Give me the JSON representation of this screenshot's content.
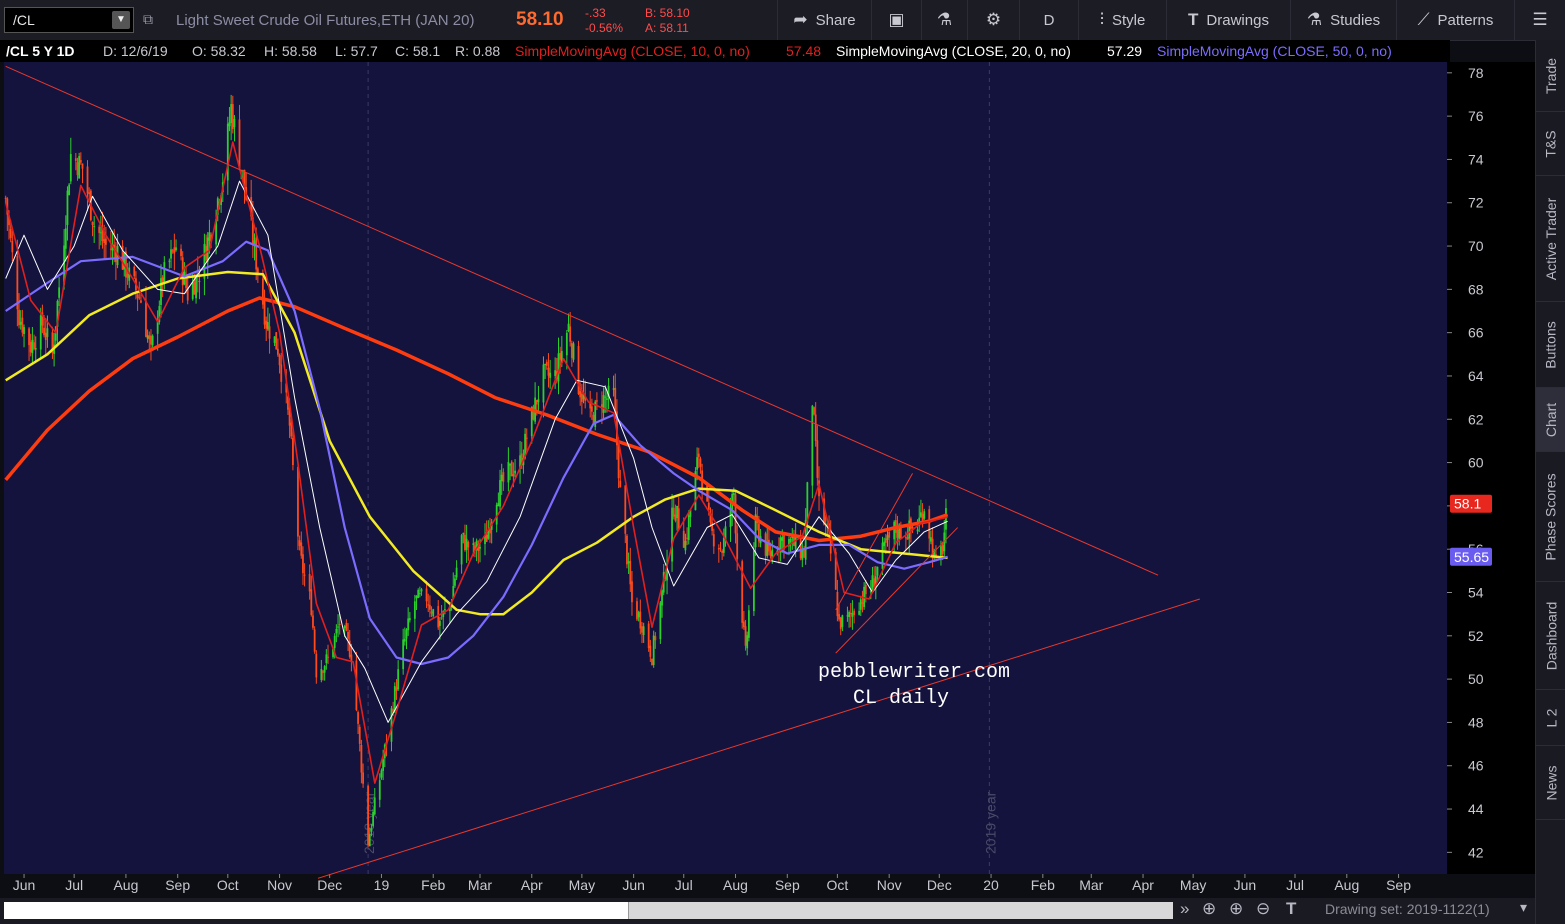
{
  "toolbar": {
    "symbol": "/CL",
    "description": "Light Sweet Crude Oil Futures,ETH (JAN 20)",
    "last": "58.10",
    "net_change": "-.33",
    "pct_change": "-0.56%",
    "bid": "B: 58.10",
    "ask": "A: 58.11",
    "share_label": "Share",
    "aggregation_label": "D",
    "style_label": "Style",
    "drawings_label": "Drawings",
    "studies_label": "Studies",
    "patterns_label": "Patterns"
  },
  "study_header": {
    "symbol_period": "/CL 5 Y 1D",
    "date": "D: 12/6/19",
    "open": "O: 58.32",
    "high": "H: 58.58",
    "low": "L: 57.7",
    "close": "C: 58.1",
    "range": "R: 0.88",
    "sma10_label": "SimpleMovingAvg (CLOSE, 10, 0, no)",
    "sma10_value": "57.48",
    "sma20_label": "SimpleMovingAvg (CLOSE, 20, 0, no)",
    "sma20_value": "57.29",
    "sma50_label": "SimpleMovingAvg (CLOSE, 50, 0, no)"
  },
  "right_tabs": [
    "Trade",
    "T&S",
    "Active Trader",
    "Buttons",
    "Chart",
    "Phase Scores",
    "Dashboard",
    "L 2",
    "News"
  ],
  "status_bar": {
    "drawing_set": "Drawing set: 2019-1122(1)"
  },
  "colors": {
    "background": "#13133d",
    "candle_up": "#2bd12b",
    "candle_down": "#ff4a1c",
    "sma10": "#e02020",
    "sma20": "#ffffff",
    "sma50": "#7b6cff",
    "sma100": "#f2ea22",
    "sma200": "#ff3c0f",
    "trendline": "#e8382d"
  },
  "chart_data": {
    "type": "candlestick",
    "title": "/CL 5 Y 1D",
    "ylim": [
      41,
      78.5
    ],
    "y_ticks": [
      42,
      44,
      46,
      48,
      50,
      52,
      54,
      56,
      58,
      60,
      62,
      64,
      66,
      68,
      70,
      72,
      74,
      76,
      78
    ],
    "x_range": [
      "2018-05-20",
      "2020-09-30"
    ],
    "x_ticks": [
      {
        "label": "Jun",
        "date": "2018-06-01"
      },
      {
        "label": "Jul",
        "date": "2018-07-01"
      },
      {
        "label": "Aug",
        "date": "2018-08-01"
      },
      {
        "label": "Sep",
        "date": "2018-09-01"
      },
      {
        "label": "Oct",
        "date": "2018-10-01"
      },
      {
        "label": "Nov",
        "date": "2018-11-01"
      },
      {
        "label": "Dec",
        "date": "2018-12-01"
      },
      {
        "label": "19",
        "date": "2019-01-01"
      },
      {
        "label": "Feb",
        "date": "2019-02-01"
      },
      {
        "label": "Mar",
        "date": "2019-03-01"
      },
      {
        "label": "Apr",
        "date": "2019-04-01"
      },
      {
        "label": "May",
        "date": "2019-05-01"
      },
      {
        "label": "Jun",
        "date": "2019-06-01"
      },
      {
        "label": "Jul",
        "date": "2019-07-01"
      },
      {
        "label": "Aug",
        "date": "2019-08-01"
      },
      {
        "label": "Sep",
        "date": "2019-09-01"
      },
      {
        "label": "Oct",
        "date": "2019-10-01"
      },
      {
        "label": "Nov",
        "date": "2019-11-01"
      },
      {
        "label": "Dec",
        "date": "2019-12-01"
      },
      {
        "label": "20",
        "date": "2020-01-01"
      },
      {
        "label": "Feb",
        "date": "2020-02-01"
      },
      {
        "label": "Mar",
        "date": "2020-03-01"
      },
      {
        "label": "Apr",
        "date": "2020-04-01"
      },
      {
        "label": "May",
        "date": "2020-05-01"
      },
      {
        "label": "Jun",
        "date": "2020-06-01"
      },
      {
        "label": "Jul",
        "date": "2020-07-01"
      },
      {
        "label": "Aug",
        "date": "2020-08-01"
      },
      {
        "label": "Sep",
        "date": "2020-09-01"
      }
    ],
    "year_markers": [
      {
        "label": "2018 year",
        "date": "2018-12-24"
      },
      {
        "label": "2019 year",
        "date": "2019-12-31"
      }
    ],
    "price_path": [
      [
        "2018-05-21",
        72.2
      ],
      [
        "2018-05-29",
        66.8
      ],
      [
        "2018-06-05",
        65.4
      ],
      [
        "2018-06-12",
        66.4
      ],
      [
        "2018-06-18",
        65.0
      ],
      [
        "2018-06-25",
        70.5
      ],
      [
        "2018-06-29",
        74.2
      ],
      [
        "2018-07-06",
        73.6
      ],
      [
        "2018-07-13",
        71.0
      ],
      [
        "2018-07-20",
        70.0
      ],
      [
        "2018-07-27",
        69.8
      ],
      [
        "2018-08-03",
        68.6
      ],
      [
        "2018-08-10",
        67.5
      ],
      [
        "2018-08-16",
        65.0
      ],
      [
        "2018-08-23",
        68.5
      ],
      [
        "2018-08-31",
        70.0
      ],
      [
        "2018-09-07",
        67.8
      ],
      [
        "2018-09-14",
        68.8
      ],
      [
        "2018-09-21",
        70.8
      ],
      [
        "2018-09-28",
        73.2
      ],
      [
        "2018-10-03",
        76.4
      ],
      [
        "2018-10-10",
        73.2
      ],
      [
        "2018-10-17",
        69.8
      ],
      [
        "2018-10-24",
        66.5
      ],
      [
        "2018-10-31",
        65.3
      ],
      [
        "2018-11-07",
        61.7
      ],
      [
        "2018-11-13",
        55.7
      ],
      [
        "2018-11-20",
        53.4
      ],
      [
        "2018-11-23",
        50.4
      ],
      [
        "2018-11-30",
        50.9
      ],
      [
        "2018-12-07",
        52.6
      ],
      [
        "2018-12-14",
        51.2
      ],
      [
        "2018-12-20",
        46.0
      ],
      [
        "2018-12-24",
        42.5
      ],
      [
        "2018-12-31",
        45.4
      ],
      [
        "2019-01-07",
        48.5
      ],
      [
        "2019-01-14",
        51.5
      ],
      [
        "2019-01-21",
        53.6
      ],
      [
        "2019-01-28",
        53.8
      ],
      [
        "2019-02-04",
        52.6
      ],
      [
        "2019-02-11",
        53.4
      ],
      [
        "2019-02-18",
        56.5
      ],
      [
        "2019-02-25",
        55.9
      ],
      [
        "2019-03-04",
        56.3
      ],
      [
        "2019-03-11",
        58.5
      ],
      [
        "2019-03-18",
        59.5
      ],
      [
        "2019-03-25",
        60.0
      ],
      [
        "2019-04-01",
        62.1
      ],
      [
        "2019-04-08",
        64.0
      ],
      [
        "2019-04-15",
        64.0
      ],
      [
        "2019-04-23",
        66.3
      ],
      [
        "2019-04-29",
        63.6
      ],
      [
        "2019-05-06",
        62.0
      ],
      [
        "2019-05-13",
        62.9
      ],
      [
        "2019-05-20",
        63.1
      ],
      [
        "2019-05-24",
        58.6
      ],
      [
        "2019-05-31",
        53.5
      ],
      [
        "2019-06-06",
        52.6
      ],
      [
        "2019-06-12",
        51.1
      ],
      [
        "2019-06-18",
        53.9
      ],
      [
        "2019-06-25",
        58.0
      ],
      [
        "2019-07-02",
        56.3
      ],
      [
        "2019-07-10",
        60.4
      ],
      [
        "2019-07-17",
        56.8
      ],
      [
        "2019-07-24",
        56.0
      ],
      [
        "2019-07-31",
        58.6
      ],
      [
        "2019-08-02",
        55.7
      ],
      [
        "2019-08-07",
        51.1
      ],
      [
        "2019-08-13",
        57.1
      ],
      [
        "2019-08-21",
        55.7
      ],
      [
        "2019-08-28",
        56.5
      ],
      [
        "2019-09-04",
        56.3
      ],
      [
        "2019-09-11",
        55.8
      ],
      [
        "2019-09-16",
        62.9
      ],
      [
        "2019-09-20",
        58.1
      ],
      [
        "2019-09-26",
        56.4
      ],
      [
        "2019-10-02",
        52.6
      ],
      [
        "2019-10-07",
        52.7
      ],
      [
        "2019-10-14",
        53.6
      ],
      [
        "2019-10-21",
        54.2
      ],
      [
        "2019-10-28",
        55.8
      ],
      [
        "2019-11-04",
        56.9
      ],
      [
        "2019-11-11",
        56.8
      ],
      [
        "2019-11-18",
        57.1
      ],
      [
        "2019-11-22",
        58.0
      ],
      [
        "2019-11-29",
        55.2
      ],
      [
        "2019-12-03",
        56.1
      ],
      [
        "2019-12-06",
        58.1
      ]
    ],
    "sma10": [
      [
        "2018-05-21",
        72.0
      ],
      [
        "2018-06-05",
        67.5
      ],
      [
        "2018-06-20",
        66.0
      ],
      [
        "2018-07-05",
        72.8
      ],
      [
        "2018-07-20",
        70.5
      ],
      [
        "2018-08-05",
        68.5
      ],
      [
        "2018-08-20",
        66.5
      ],
      [
        "2018-09-05",
        69.0
      ],
      [
        "2018-09-20",
        69.8
      ],
      [
        "2018-10-04",
        74.8
      ],
      [
        "2018-10-20",
        70.0
      ],
      [
        "2018-11-01",
        66.0
      ],
      [
        "2018-11-12",
        60.0
      ],
      [
        "2018-11-23",
        53.5
      ],
      [
        "2018-12-05",
        51.0
      ],
      [
        "2018-12-15",
        50.8
      ],
      [
        "2018-12-28",
        45.2
      ],
      [
        "2019-01-10",
        48.5
      ],
      [
        "2019-01-25",
        52.5
      ],
      [
        "2019-02-10",
        53.2
      ],
      [
        "2019-02-25",
        55.8
      ],
      [
        "2019-03-15",
        58.0
      ],
      [
        "2019-04-01",
        61.0
      ],
      [
        "2019-04-20",
        64.8
      ],
      [
        "2019-05-05",
        62.8
      ],
      [
        "2019-05-20",
        62.3
      ],
      [
        "2019-06-01",
        57.0
      ],
      [
        "2019-06-12",
        52.4
      ],
      [
        "2019-06-25",
        56.5
      ],
      [
        "2019-07-10",
        58.5
      ],
      [
        "2019-07-25",
        56.6
      ],
      [
        "2019-08-10",
        54.2
      ],
      [
        "2019-08-25",
        55.8
      ],
      [
        "2019-09-10",
        56.6
      ],
      [
        "2019-09-20",
        59.0
      ],
      [
        "2019-10-05",
        54.0
      ],
      [
        "2019-10-20",
        53.7
      ],
      [
        "2019-11-05",
        56.3
      ],
      [
        "2019-11-20",
        57.2
      ],
      [
        "2019-12-06",
        57.48
      ]
    ],
    "sma20": [
      [
        "2018-05-21",
        68.5
      ],
      [
        "2018-06-01",
        70.5
      ],
      [
        "2018-06-15",
        68.0
      ],
      [
        "2018-07-01",
        70.0
      ],
      [
        "2018-07-12",
        72.3
      ],
      [
        "2018-07-30",
        69.8
      ],
      [
        "2018-08-20",
        68.0
      ],
      [
        "2018-09-05",
        67.8
      ],
      [
        "2018-09-25",
        70.0
      ],
      [
        "2018-10-08",
        73.0
      ],
      [
        "2018-10-25",
        70.5
      ],
      [
        "2018-11-10",
        63.0
      ],
      [
        "2018-11-25",
        57.0
      ],
      [
        "2018-12-10",
        52.0
      ],
      [
        "2018-12-22",
        50.5
      ],
      [
        "2019-01-05",
        48.0
      ],
      [
        "2019-01-25",
        50.8
      ],
      [
        "2019-02-15",
        53.0
      ],
      [
        "2019-03-05",
        54.5
      ],
      [
        "2019-03-25",
        57.5
      ],
      [
        "2019-04-15",
        62.0
      ],
      [
        "2019-04-28",
        63.8
      ],
      [
        "2019-05-15",
        63.5
      ],
      [
        "2019-06-01",
        60.2
      ],
      [
        "2019-06-12",
        57.0
      ],
      [
        "2019-06-25",
        54.3
      ],
      [
        "2019-07-15",
        57.0
      ],
      [
        "2019-07-30",
        57.6
      ],
      [
        "2019-08-15",
        55.6
      ],
      [
        "2019-09-01",
        55.3
      ],
      [
        "2019-09-20",
        57.5
      ],
      [
        "2019-10-08",
        55.8
      ],
      [
        "2019-10-22",
        54.0
      ],
      [
        "2019-11-05",
        55.5
      ],
      [
        "2019-11-22",
        56.8
      ],
      [
        "2019-12-06",
        57.29
      ]
    ],
    "sma50": [
      [
        "2018-05-21",
        67.0
      ],
      [
        "2018-06-15",
        68.3
      ],
      [
        "2018-07-05",
        69.3
      ],
      [
        "2018-08-05",
        69.5
      ],
      [
        "2018-09-05",
        68.6
      ],
      [
        "2018-09-28",
        69.3
      ],
      [
        "2018-10-12",
        70.2
      ],
      [
        "2018-10-25",
        69.8
      ],
      [
        "2018-11-10",
        67.0
      ],
      [
        "2018-11-25",
        62.5
      ],
      [
        "2018-12-10",
        57.0
      ],
      [
        "2018-12-25",
        52.8
      ],
      [
        "2019-01-10",
        51.0
      ],
      [
        "2019-01-25",
        50.7
      ],
      [
        "2019-02-10",
        51.0
      ],
      [
        "2019-02-25",
        52.0
      ],
      [
        "2019-03-15",
        53.8
      ],
      [
        "2019-04-01",
        56.2
      ],
      [
        "2019-04-20",
        59.3
      ],
      [
        "2019-05-08",
        61.8
      ],
      [
        "2019-05-20",
        62.2
      ],
      [
        "2019-06-05",
        60.8
      ],
      [
        "2019-06-25",
        59.5
      ],
      [
        "2019-07-10",
        58.7
      ],
      [
        "2019-07-30",
        57.8
      ],
      [
        "2019-08-15",
        56.5
      ],
      [
        "2019-09-01",
        55.8
      ],
      [
        "2019-09-20",
        56.2
      ],
      [
        "2019-10-08",
        56.2
      ],
      [
        "2019-10-25",
        55.4
      ],
      [
        "2019-11-10",
        55.1
      ],
      [
        "2019-11-25",
        55.4
      ],
      [
        "2019-12-06",
        55.65
      ]
    ],
    "sma100": [
      [
        "2018-05-21",
        63.8
      ],
      [
        "2018-06-15",
        65.0
      ],
      [
        "2018-07-10",
        66.8
      ],
      [
        "2018-08-05",
        67.8
      ],
      [
        "2018-09-01",
        68.5
      ],
      [
        "2018-10-01",
        68.8
      ],
      [
        "2018-10-22",
        68.7
      ],
      [
        "2018-11-10",
        66.0
      ],
      [
        "2018-12-01",
        61.0
      ],
      [
        "2018-12-25",
        57.5
      ],
      [
        "2019-01-20",
        55.0
      ],
      [
        "2019-02-15",
        53.2
      ],
      [
        "2019-03-01",
        53.0
      ],
      [
        "2019-03-15",
        53.0
      ],
      [
        "2019-04-01",
        54.0
      ],
      [
        "2019-04-20",
        55.5
      ],
      [
        "2019-05-10",
        56.3
      ],
      [
        "2019-06-01",
        57.5
      ],
      [
        "2019-06-20",
        58.3
      ],
      [
        "2019-07-10",
        58.8
      ],
      [
        "2019-08-01",
        58.7
      ],
      [
        "2019-08-25",
        57.8
      ],
      [
        "2019-09-20",
        56.8
      ],
      [
        "2019-10-15",
        56.0
      ],
      [
        "2019-11-10",
        55.8
      ],
      [
        "2019-12-06",
        55.6
      ]
    ],
    "sma200": [
      [
        "2018-05-21",
        59.2
      ],
      [
        "2018-06-15",
        61.5
      ],
      [
        "2018-07-10",
        63.3
      ],
      [
        "2018-08-05",
        64.8
      ],
      [
        "2018-09-01",
        65.8
      ],
      [
        "2018-10-01",
        67.0
      ],
      [
        "2018-10-20",
        67.6
      ],
      [
        "2018-11-10",
        67.2
      ],
      [
        "2018-12-10",
        66.2
      ],
      [
        "2019-01-10",
        65.2
      ],
      [
        "2019-02-10",
        64.1
      ],
      [
        "2019-03-10",
        63.0
      ],
      [
        "2019-04-10",
        62.2
      ],
      [
        "2019-05-10",
        61.3
      ],
      [
        "2019-06-10",
        60.5
      ],
      [
        "2019-07-10",
        59.3
      ],
      [
        "2019-08-05",
        57.8
      ],
      [
        "2019-08-25",
        56.8
      ],
      [
        "2019-09-20",
        56.4
      ],
      [
        "2019-10-15",
        56.6
      ],
      [
        "2019-11-05",
        57.0
      ],
      [
        "2019-11-25",
        57.3
      ],
      [
        "2019-12-06",
        57.6
      ]
    ],
    "trendlines": [
      {
        "name": "upper",
        "from": [
          "2018-05-21",
          78.3
        ],
        "to": [
          "2020-04-10",
          54.8
        ]
      },
      {
        "name": "lower",
        "from": [
          "2018-11-24",
          40.8
        ],
        "to": [
          "2020-05-05",
          53.7
        ]
      },
      {
        "name": "channel-lower",
        "from": [
          "2019-09-30",
          51.2
        ],
        "to": [
          "2019-12-12",
          57.0
        ]
      },
      {
        "name": "channel-upper",
        "from": [
          "2019-09-30",
          53.2
        ],
        "to": [
          "2019-11-15",
          59.5
        ]
      }
    ],
    "annotation": [
      "pebblewriter.com",
      "CL daily"
    ],
    "price_labels": [
      {
        "label": "58.1",
        "value": 58.1,
        "color": "#e8281e"
      },
      {
        "label": "55.65",
        "value": 55.65,
        "color": "#6b5cf0"
      }
    ]
  }
}
